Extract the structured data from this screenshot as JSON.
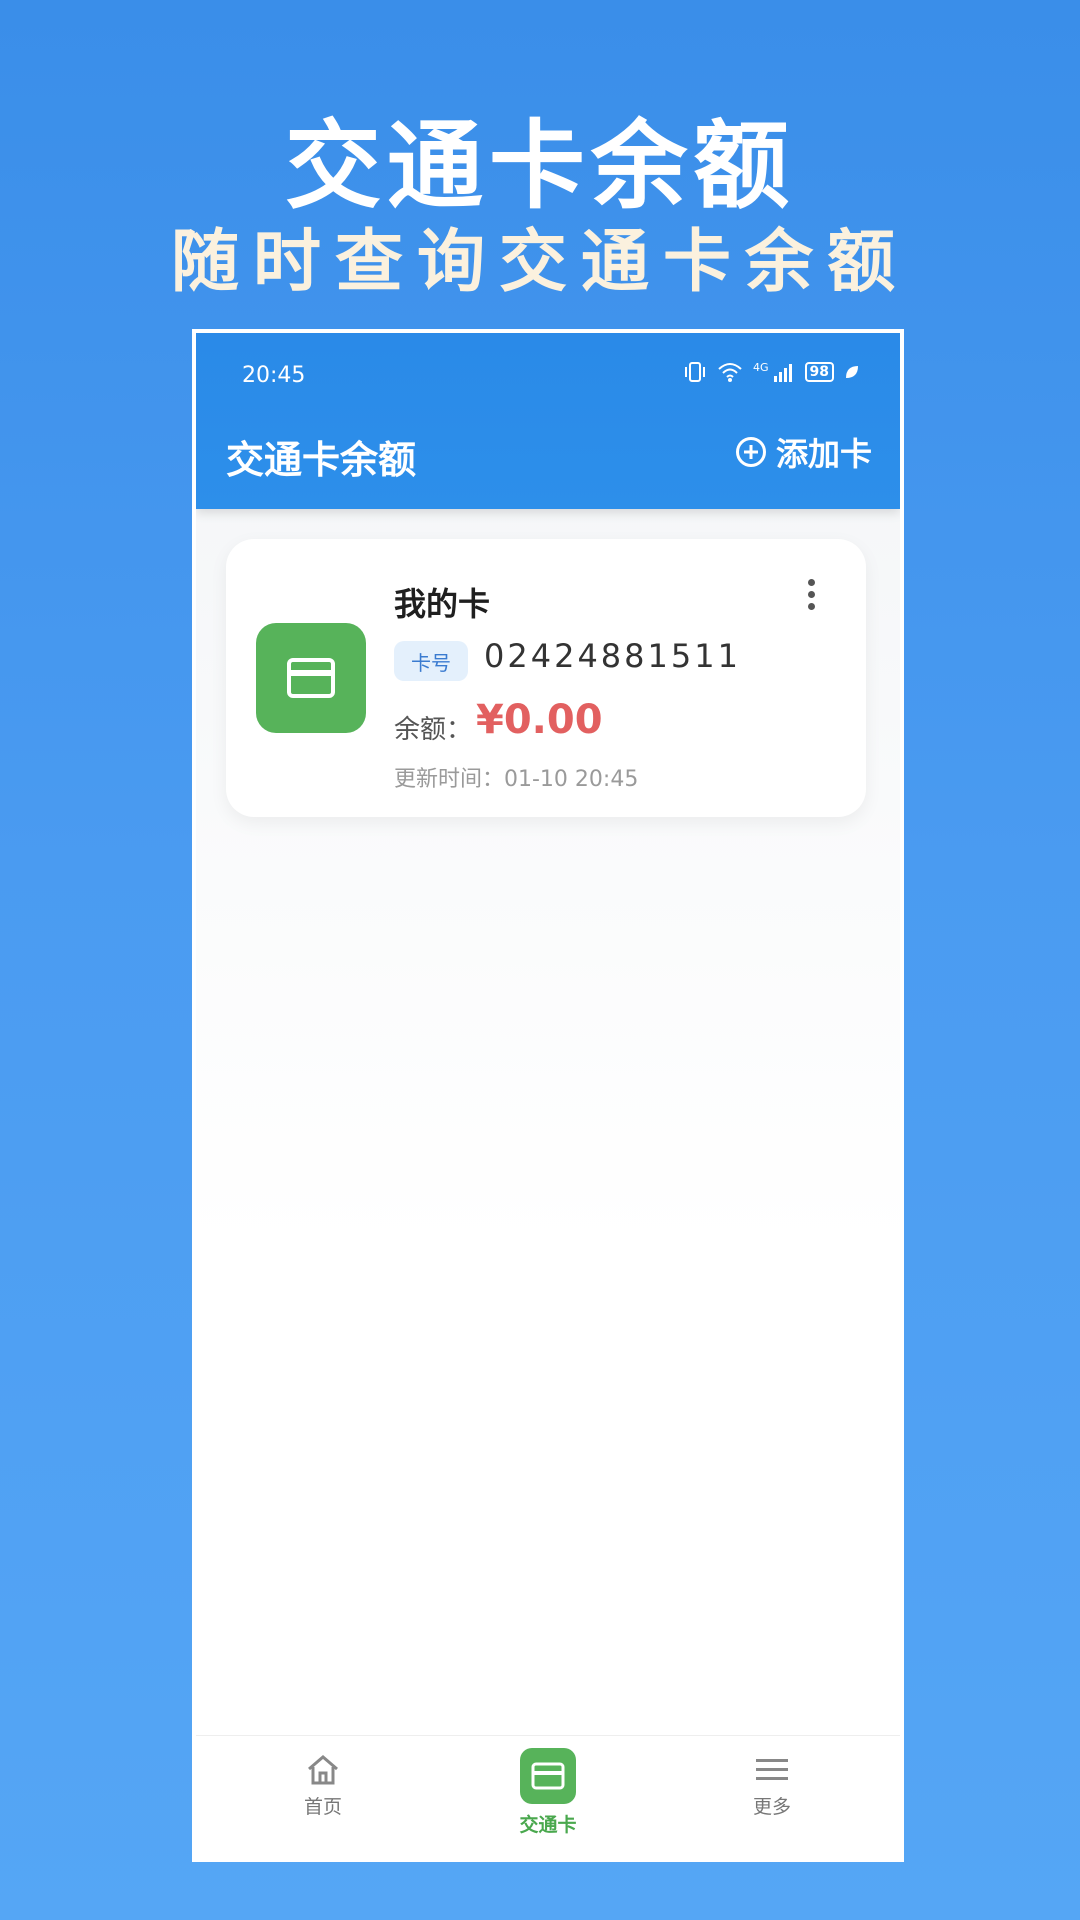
{
  "promo": {
    "title": "交通卡余额",
    "subtitle": "随时查询交通卡余额"
  },
  "status_bar": {
    "time": "20:45",
    "network": "4G",
    "battery": "98"
  },
  "app_bar": {
    "title": "交通卡余额",
    "add_label": "添加卡"
  },
  "card": {
    "name": "我的卡",
    "number_tag": "卡号",
    "number": "02424881511",
    "balance_label": "余额：",
    "balance": "¥0.00",
    "updated": "更新时间：01-10 20:45"
  },
  "tabs": [
    {
      "label": "首页",
      "icon": "home-icon"
    },
    {
      "label": "交通卡",
      "icon": "card-icon"
    },
    {
      "label": "更多",
      "icon": "menu-icon"
    }
  ],
  "colors": {
    "accent_blue": "#2d8fea",
    "card_green": "#57b35a",
    "balance_red": "#e26060"
  }
}
